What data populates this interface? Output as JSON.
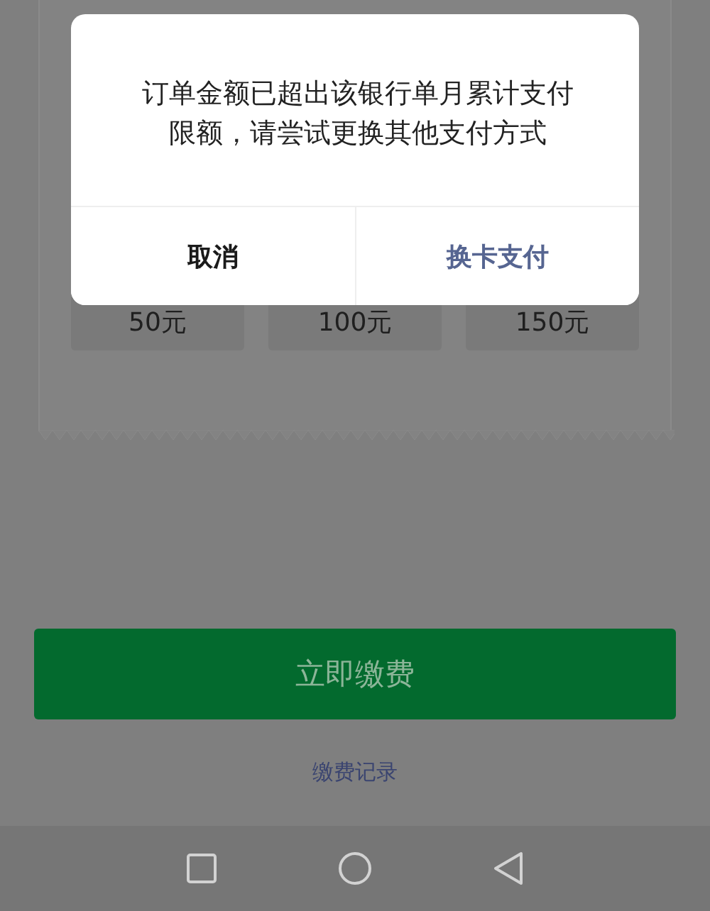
{
  "amount_options": [
    {
      "label": "50元"
    },
    {
      "label": "100元"
    },
    {
      "label": "150元"
    }
  ],
  "pay_button": {
    "label": "立即缴费"
  },
  "history_link": {
    "label": "缴费记录"
  },
  "dialog": {
    "message": "订单金额已超出该银行单月累计支付限额，请尝试更换其他支付方式",
    "buttons": [
      {
        "label": "取消",
        "kind": "cancel"
      },
      {
        "label": "换卡支付",
        "kind": "confirm"
      }
    ]
  }
}
